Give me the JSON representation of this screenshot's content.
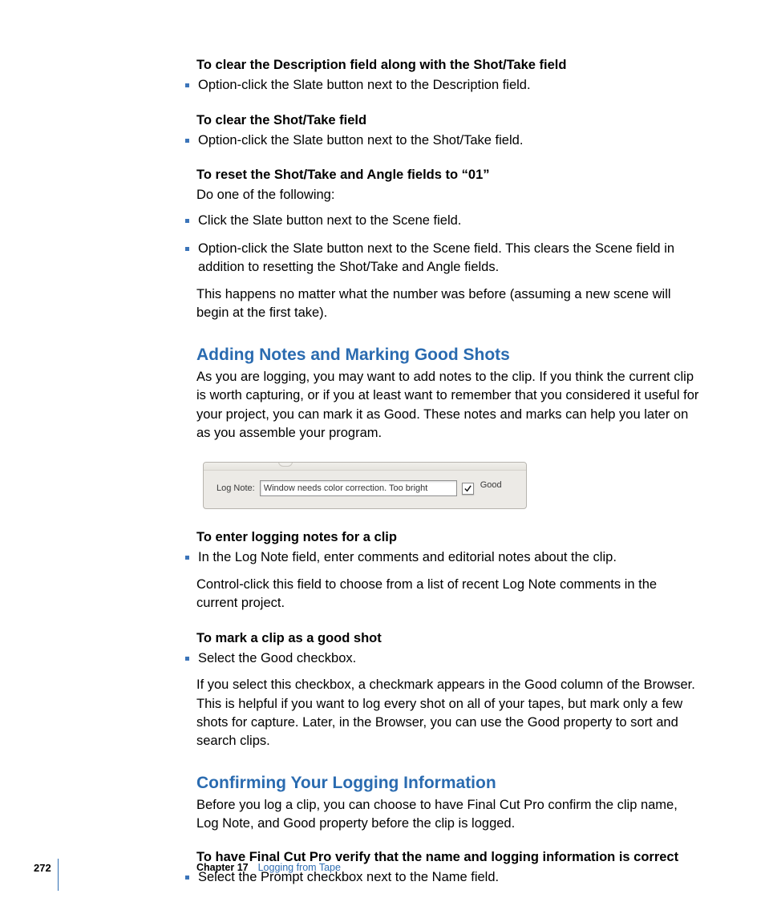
{
  "sections": {
    "s1": {
      "heading": "To clear the Description field along with the Shot/Take field",
      "bullets": [
        "Option-click the Slate button next to the Description field."
      ]
    },
    "s2": {
      "heading": "To clear the Shot/Take field",
      "bullets": [
        "Option-click the Slate button next to the Shot/Take field."
      ]
    },
    "s3": {
      "heading": "To reset the Shot/Take and Angle fields to “01”",
      "sub": "Do one of the following:",
      "bullets": [
        "Click the Slate button next to the Scene field.",
        "Option-click the Slate button next to the Scene field. This clears the Scene field in addition to resetting the Shot/Take and Angle fields."
      ],
      "tail": "This happens no matter what the number was before (assuming a new scene will begin at the first take)."
    },
    "h1": {
      "title": "Adding Notes and Marking Good Shots",
      "para": "As you are logging, you may want to add notes to the clip. If you think the current clip is worth capturing, or if you at least want to remember that you considered it useful for your project, you can mark it as Good. These notes and marks can help you later on as you assemble your program."
    },
    "ui": {
      "label": "Log Note:",
      "value": "Window needs color correction. Too bright",
      "good": "Good"
    },
    "s4": {
      "heading": "To enter logging notes for a clip",
      "bullets": [
        "In the Log Note field, enter comments and editorial notes about the clip."
      ],
      "tail": "Control-click this field to choose from a list of recent Log Note comments in the current project."
    },
    "s5": {
      "heading": "To mark a clip as a good shot",
      "bullets": [
        "Select the Good checkbox."
      ],
      "tail": "If you select this checkbox, a checkmark appears in the Good column of the Browser. This is helpful if you want to log every shot on all of your tapes, but mark only a few shots for capture. Later, in the Browser, you can use the Good property to sort and search clips."
    },
    "h2": {
      "title": "Confirming Your Logging Information",
      "para": "Before you log a clip, you can choose to have Final Cut Pro confirm the clip name, Log Note, and Good property before the clip is logged."
    },
    "s6": {
      "heading": "To have Final Cut Pro verify that the name and logging information is correct",
      "bullets": [
        "Select the Prompt checkbox next to the Name field."
      ]
    }
  },
  "footer": {
    "page": "272",
    "chapter_label": "Chapter 17",
    "chapter_title": "Logging from Tape"
  }
}
